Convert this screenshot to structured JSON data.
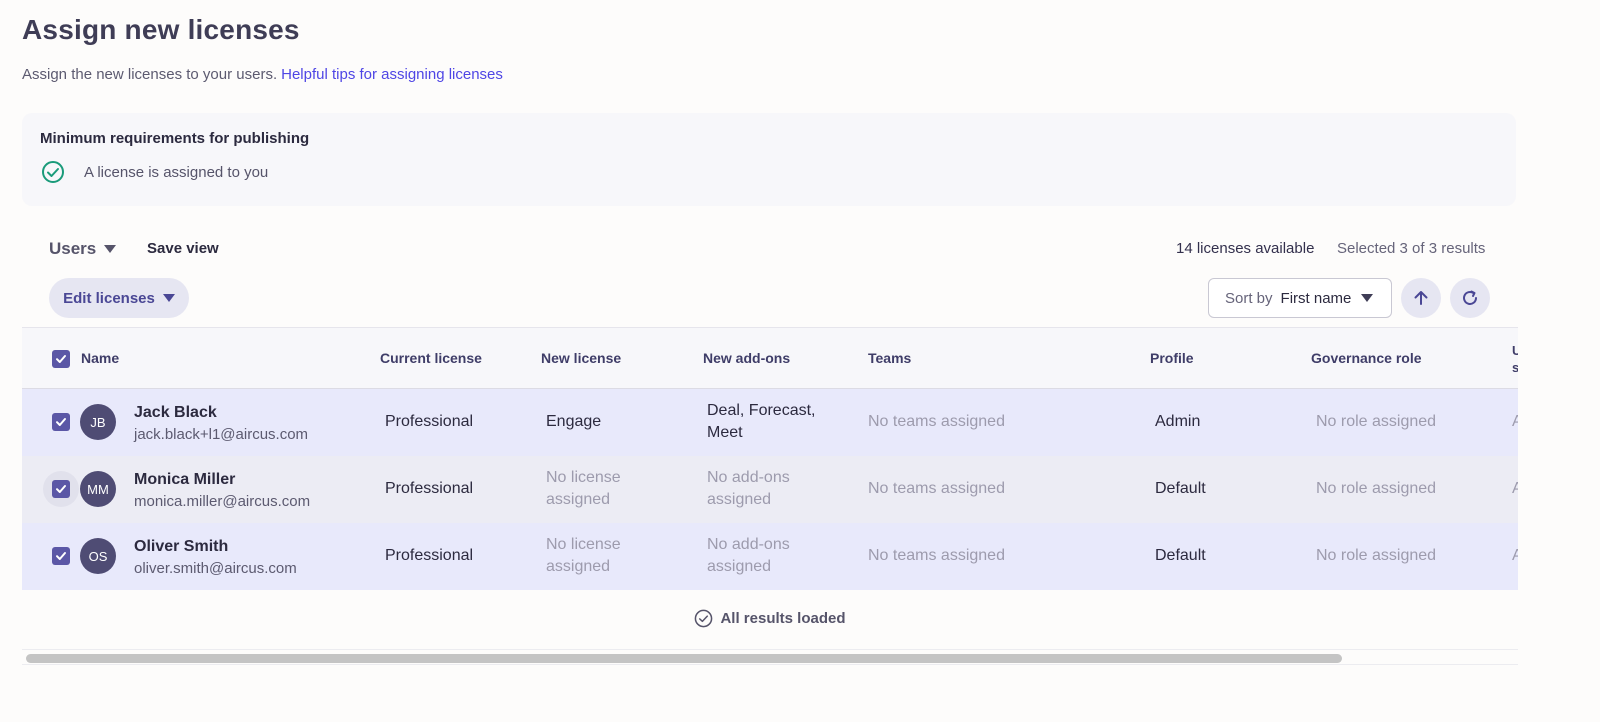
{
  "page": {
    "title": "Assign new licenses",
    "subtitle": "Assign the new licenses to your users.",
    "help_link": "Helpful tips for assigning licenses"
  },
  "requirements": {
    "title": "Minimum requirements for publishing",
    "items": [
      {
        "text": "A license is assigned to you",
        "status": "complete",
        "icon": "check-circle-icon",
        "color": "#1a9b7a"
      }
    ]
  },
  "toolbar": {
    "view_label": "Users",
    "save_view_label": "Save view",
    "licenses_available": "14 licenses available",
    "selected_count": "Selected 3 of 3 results",
    "edit_licenses_label": "Edit licenses",
    "sort_label": "Sort by",
    "sort_value": "First name"
  },
  "table": {
    "columns": {
      "name": "Name",
      "current_license": "Current license",
      "new_license": "New license",
      "new_addons": "New add-ons",
      "teams": "Teams",
      "profile": "Profile",
      "governance_role": "Governance role",
      "cut_off_line1": "U",
      "cut_off_line2": "st"
    },
    "rows": [
      {
        "checked": true,
        "initials": "JB",
        "name": "Jack Black",
        "email": "jack.black+l1@aircus.com",
        "current_license": "Professional",
        "new_license": "Engage",
        "new_addons_line1": "Deal, Forecast,",
        "new_addons_line2": "Meet",
        "teams": "No teams assigned",
        "profile": "Admin",
        "governance_role": "No role assigned",
        "cut_off": "A"
      },
      {
        "checked": true,
        "initials": "MM",
        "name": "Monica Miller",
        "email": "monica.miller@aircus.com",
        "current_license": "Professional",
        "new_license_line1": "No license",
        "new_license_line2": "assigned",
        "new_addons_line1": "No add-ons",
        "new_addons_line2": "assigned",
        "teams": "No teams assigned",
        "profile": "Default",
        "governance_role": "No role assigned",
        "cut_off": "A"
      },
      {
        "checked": true,
        "initials": "OS",
        "name": "Oliver Smith",
        "email": "oliver.smith@aircus.com",
        "current_license": "Professional",
        "new_license_line1": "No license",
        "new_license_line2": "assigned",
        "new_addons_line1": "No add-ons",
        "new_addons_line2": "assigned",
        "teams": "No teams assigned",
        "profile": "Default",
        "governance_role": "No role assigned",
        "cut_off": "A"
      }
    ],
    "footer": "All results loaded"
  },
  "colors": {
    "accent": "#5b57a6",
    "link": "#4f46e5",
    "success": "#1a9b7a",
    "selected_row": "#e8e9fb"
  }
}
